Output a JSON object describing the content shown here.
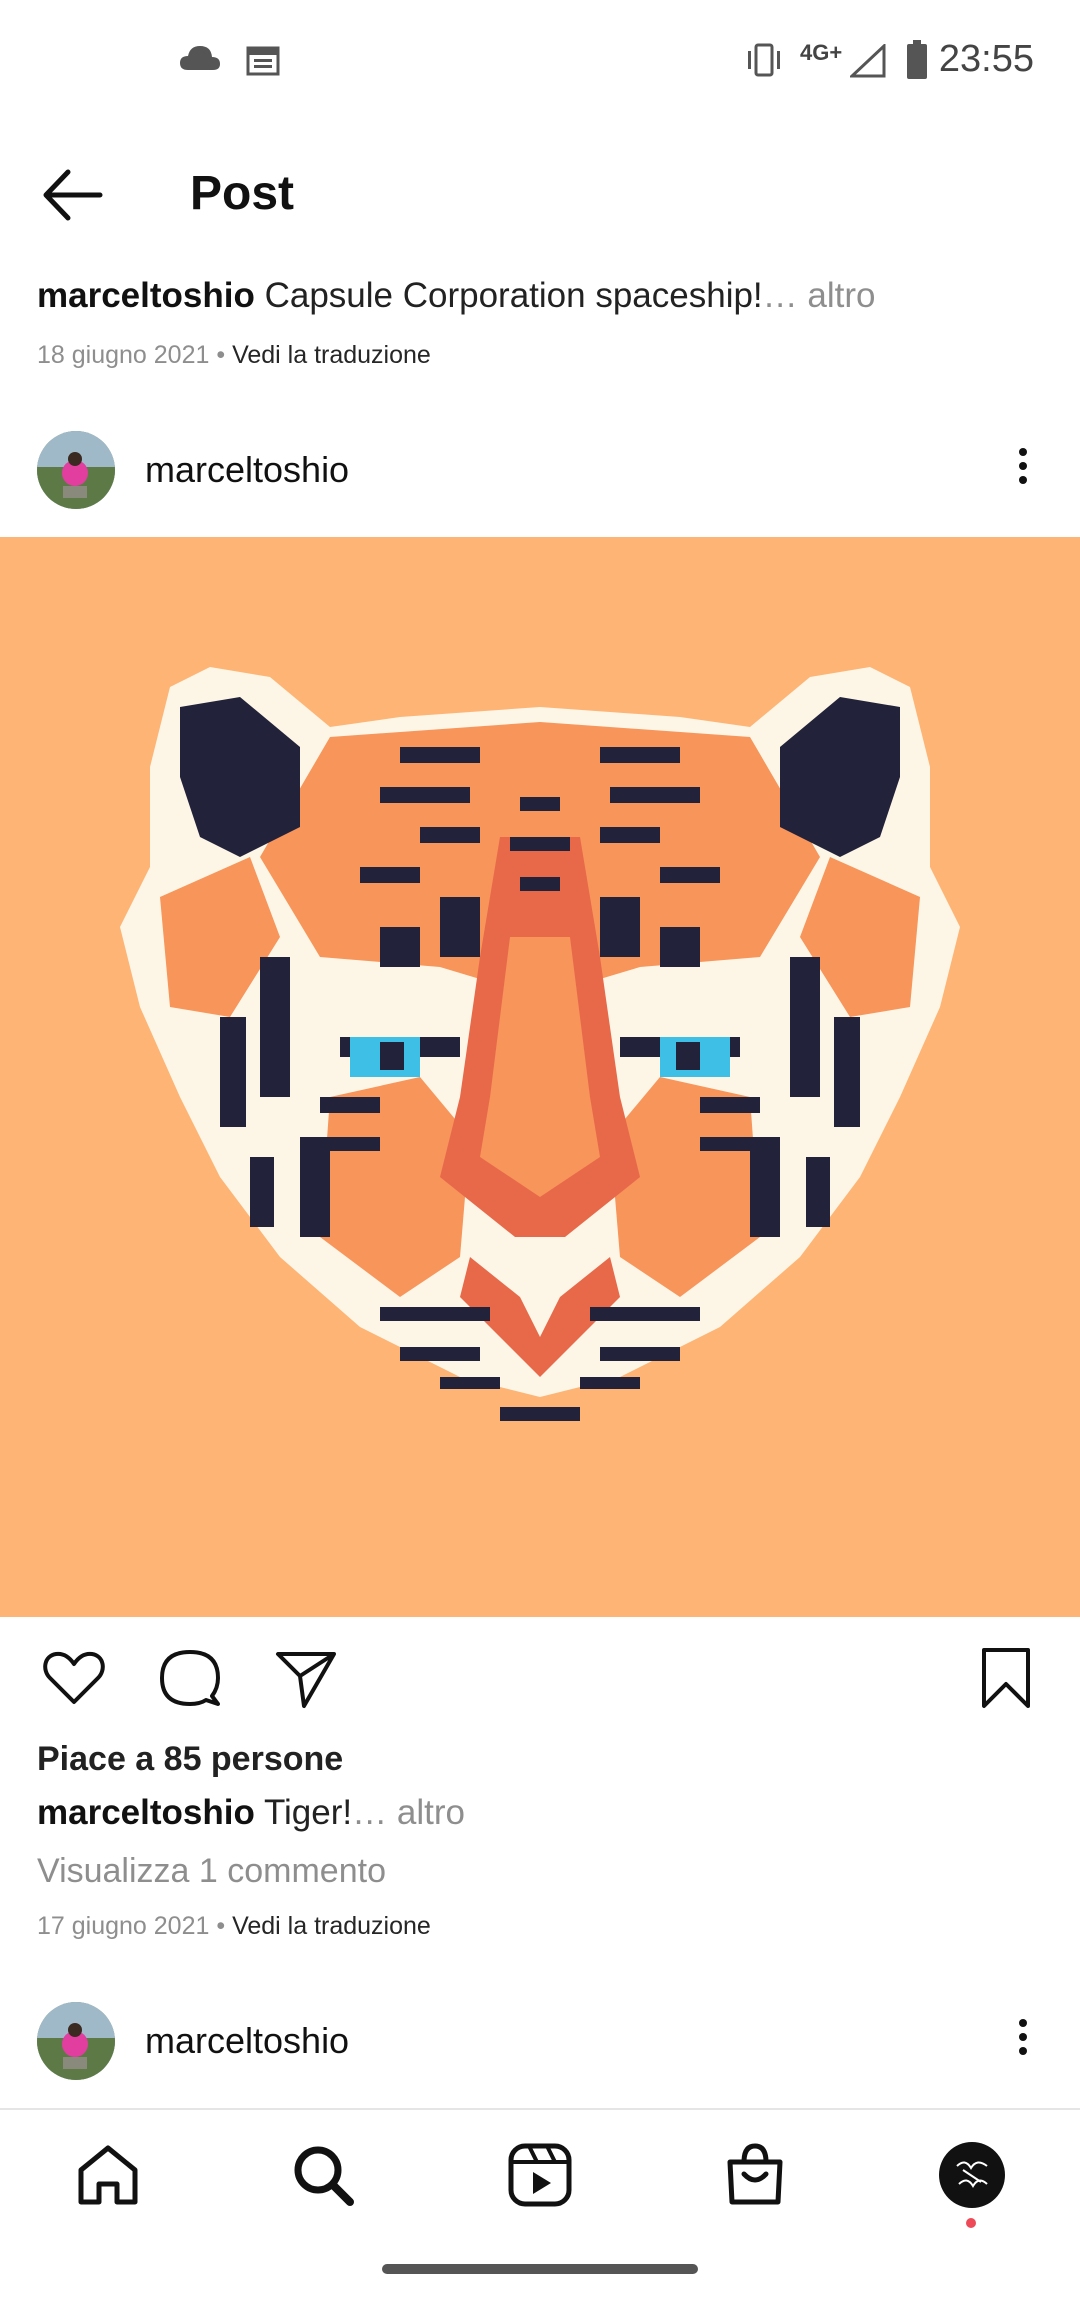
{
  "status_bar": {
    "time": "23:55",
    "network": "4G+",
    "icons": [
      "cloud-icon",
      "calendar-icon",
      "vibrate-icon",
      "signal-icon",
      "battery-icon"
    ]
  },
  "header": {
    "title": "Post",
    "back_icon": "back-arrow-icon"
  },
  "previous_post": {
    "username": "marceltoshio",
    "caption": "Capsule Corporation spaceship!",
    "more": "… altro",
    "date": "18 giugno 2021",
    "separator": "•",
    "translate": "Vedi la traduzione"
  },
  "post": {
    "username": "marceltoshio",
    "image_subject": "pixel art tiger head",
    "likes": "Piace a 85 persone",
    "caption": "Tiger!",
    "more": "… altro",
    "comments": "Visualizza 1 commento",
    "date": "17 giugno 2021",
    "separator": "•",
    "translate": "Vedi la traduzione"
  },
  "next_post": {
    "username": "marceltoshio"
  },
  "bottom_nav": {
    "items": [
      "home-icon",
      "search-icon",
      "reels-icon",
      "shop-icon",
      "profile-avatar"
    ]
  },
  "colors": {
    "image_background": "#fdb475",
    "tiger_orange": "#f7955a",
    "tiger_dark": "#22223a",
    "tiger_white": "#fdf6e6",
    "eye_blue": "#3ec0e6",
    "notification_dot": "#ed4956"
  }
}
